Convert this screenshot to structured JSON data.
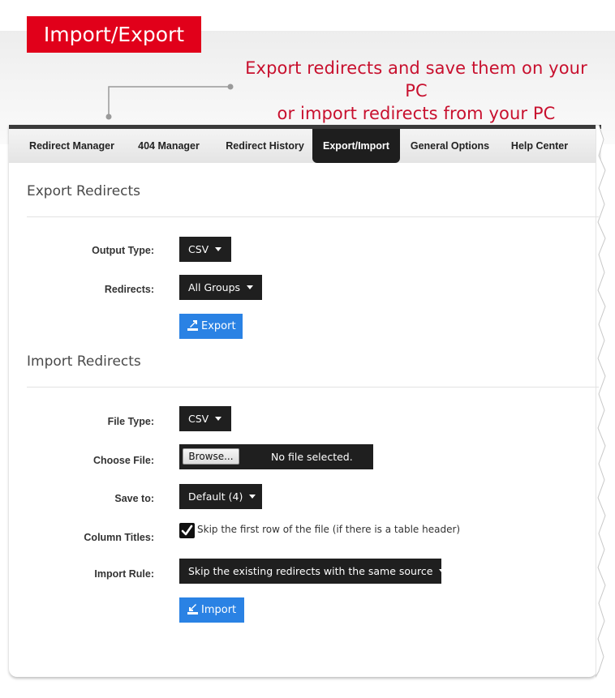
{
  "header": {
    "title": "Import/Export",
    "subtitle_line1": "Export redirects and save them on your PC",
    "subtitle_line2": "or import redirects from your PC"
  },
  "tabs": [
    {
      "label": "Redirect Manager",
      "active": false
    },
    {
      "label": "404 Manager",
      "active": false
    },
    {
      "label": "Redirect History",
      "active": false
    },
    {
      "label": "Export/Import",
      "active": true
    },
    {
      "label": "General Options",
      "active": false
    },
    {
      "label": "Help Center",
      "active": false
    }
  ],
  "export_section": {
    "title": "Export Redirects",
    "output_type_label": "Output Type:",
    "output_type_value": "CSV",
    "redirects_label": "Redirects:",
    "redirects_value": "All Groups",
    "export_button": "Export"
  },
  "import_section": {
    "title": "Import Redirects",
    "file_type_label": "File Type:",
    "file_type_value": "CSV",
    "choose_file_label": "Choose File:",
    "browse_button": "Browse...",
    "file_status": "No file selected.",
    "save_to_label": "Save to:",
    "save_to_value": "Default (4)",
    "column_titles_label": "Column Titles:",
    "column_titles_checkbox": "Skip the first row of the file (if there is a table header)",
    "column_titles_checked": true,
    "import_rule_label": "Import Rule:",
    "import_rule_value": "Skip the existing redirects with the same source",
    "import_button": "Import"
  },
  "colors": {
    "brand_red": "#e1001a",
    "subtitle_red": "#c8102e",
    "button_blue": "#2a82e4",
    "dark": "#1f1f1f"
  },
  "icons": {
    "export": "export-icon",
    "import": "import-icon",
    "caret": "caret-down-icon",
    "check": "checkmark-icon"
  }
}
